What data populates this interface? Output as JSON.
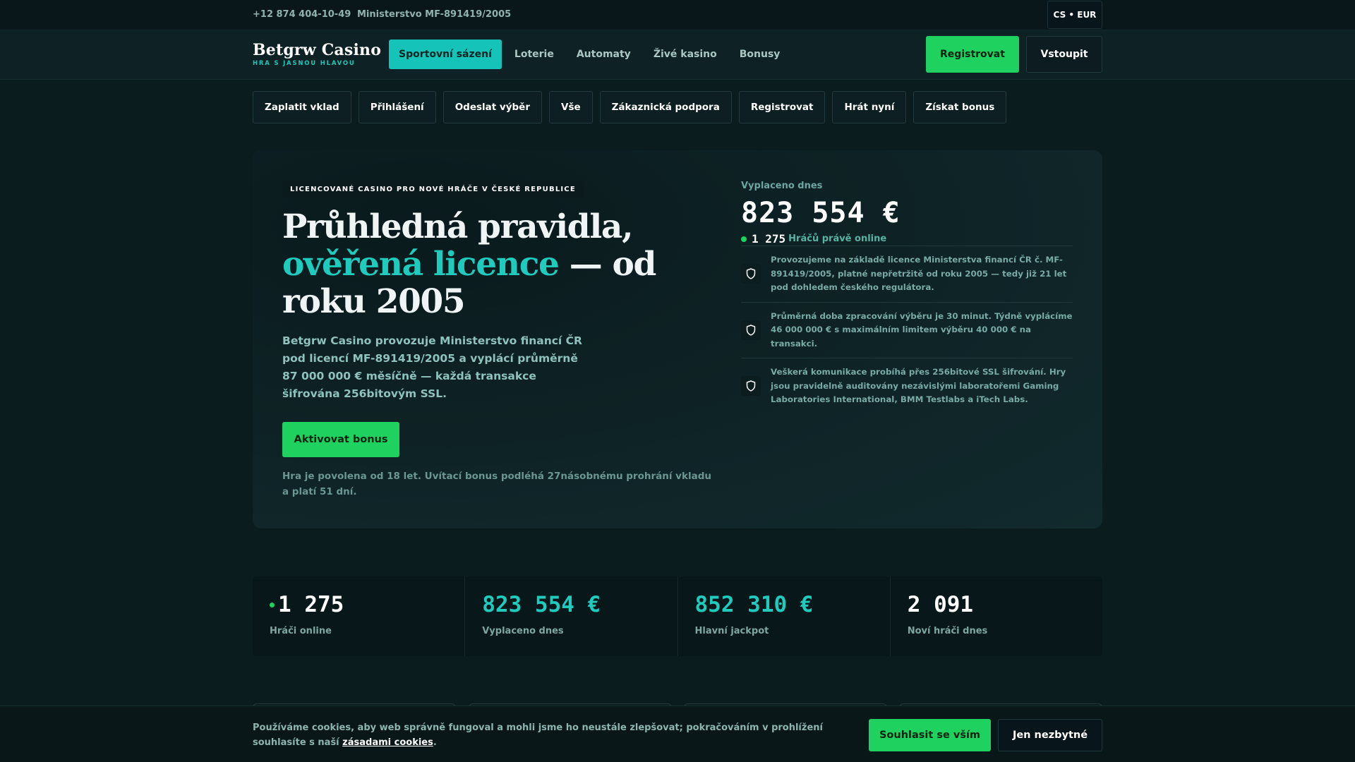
{
  "topbar": {
    "phone": "+12 874 404-10-49",
    "license": "Ministerstvo MF-891419/2005",
    "lang": "CS • EUR"
  },
  "header": {
    "logo_name": "Betgrw Casino",
    "logo_tagline": "HRA S JASNOU HLAVOU",
    "nav": [
      {
        "label": "Sportovní sázení",
        "active": true
      },
      {
        "label": "Loterie"
      },
      {
        "label": "Automaty"
      },
      {
        "label": "Živé kasino"
      },
      {
        "label": "Bonusy"
      }
    ],
    "register_label": "Registrovat",
    "login_label": "Vstoupit"
  },
  "quick_links": [
    "Zaplatit vklad",
    "Přihlášení",
    "Odeslat výběr",
    "Vše",
    "Zákaznická podpora",
    "Registrovat",
    "Hrát nyní",
    "Získat bonus"
  ],
  "hero": {
    "badge": "LICENCOVANÉ CASINO PRO NOVÉ HRÁČE V ČESKÉ REPUBLICE",
    "title_part1": "Průhledná pravidla, ",
    "title_accent": "ověřená licence",
    "title_part2": " — od roku 2005",
    "lead": "Betgrw Casino provozuje Ministerstvo financí ČR pod licencí MF-891419/2005 a vyplácí průměrně 87 000 000 € měsíčně — každá transakce šifrována 256bitovým SSL.",
    "cta_label": "Aktivovat bonus",
    "fine_print": "Hra je povolena od 18 let. Uvítací bonus podléhá 27násobnému prohrání vkladu a platí 51 dní.",
    "payout_label": "Vyplaceno dnes",
    "payout_amount": "823 554 €",
    "online_count": "1 275",
    "online_label": "Hráčů právě online",
    "features": [
      {
        "icon": "shield-icon",
        "text": "Provozujeme na základě licence Ministerstva financí ČR č. MF-891419/2005, platné nepřetržitě od roku 2005 — tedy již 21 let pod dohledem českého regulátora."
      },
      {
        "icon": "shield-icon",
        "text": "Průměrná doba zpracování výběru je 30 minut. Týdně vyplácíme 46 000 000 € s maximálním limitem výběru 40 000 € na transakci."
      },
      {
        "icon": "shield-icon",
        "text": "Veškerá komunikace probíhá přes 256bitové SSL šifrování. Hry jsou pravidelně auditovány nezávislými laboratořemi Gaming Laboratories International, BMM Testlabs a iTech Labs."
      }
    ]
  },
  "stats": [
    {
      "value": "1 275",
      "label": "Hráči online"
    },
    {
      "value": "823 554 €",
      "label": "Vyplaceno dnes"
    },
    {
      "value": "852 310 €",
      "label": "Hlavní jackpot"
    },
    {
      "value": "2 091",
      "label": "Noví hráči dnes"
    }
  ],
  "cookie": {
    "message": "Používáme cookies, aby web správně fungoval a mohli jsme ho neustále zlepšovat; pokračováním v prohlížení souhlasíte s naší ",
    "link": "zásadami cookies",
    "period": ".",
    "accept_label": "Souhlasit se vším",
    "essential_label": "Jen nezbytné"
  },
  "colors": {
    "accent_teal": "#1ecbbd",
    "accent_green": "#1fd15f",
    "background": "#0b1c1f"
  }
}
